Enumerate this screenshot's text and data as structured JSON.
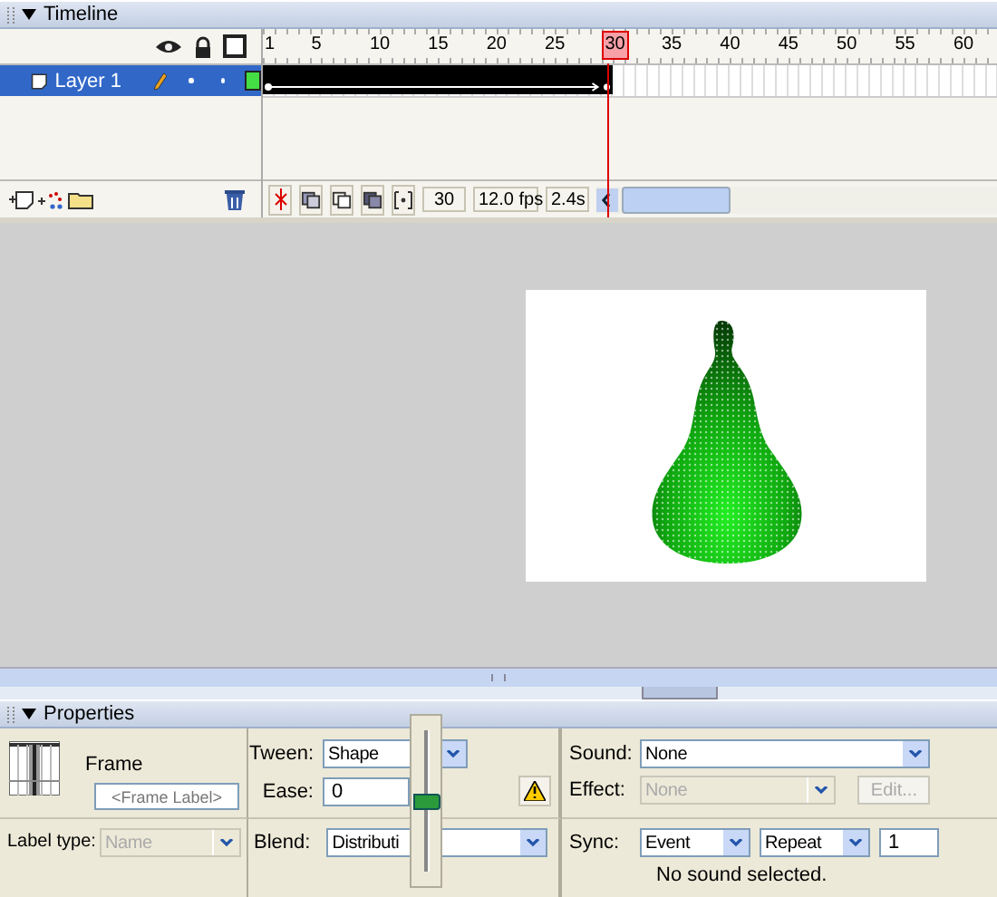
{
  "timeline": {
    "title": "Timeline",
    "layers": [
      {
        "name": "Layer 1",
        "selected": true,
        "color": "#44dd44"
      }
    ],
    "ruler": [
      {
        "label": "1",
        "selected": false
      },
      {
        "label": "5",
        "selected": false
      },
      {
        "label": "10",
        "selected": false
      },
      {
        "label": "15",
        "selected": false
      },
      {
        "label": "20",
        "selected": false
      },
      {
        "label": "25",
        "selected": false
      },
      {
        "label": "30",
        "selected": true
      },
      {
        "label": "35",
        "selected": false
      },
      {
        "label": "40",
        "selected": false
      },
      {
        "label": "45",
        "selected": false
      },
      {
        "label": "50",
        "selected": false
      },
      {
        "label": "55",
        "selected": false
      },
      {
        "label": "60",
        "selected": false
      }
    ],
    "toolbar": {
      "current_frame": "30",
      "frame_rate": "12.0 fps",
      "elapsed_time": "2.4s"
    }
  },
  "properties": {
    "title": "Properties",
    "frame_title": "Frame",
    "frame_label": {
      "placeholder": "<Frame Label>"
    },
    "label_type": {
      "label": "Label type:",
      "value": "Name",
      "disabled": true
    },
    "tween": {
      "label": "Tween:",
      "value": "Shape"
    },
    "ease": {
      "label": "Ease:",
      "value": "0",
      "level": 0.5
    },
    "blend": {
      "label": "Blend:",
      "value": "Distributi"
    },
    "sound": {
      "label": "Sound:",
      "value": "None"
    },
    "effect": {
      "label": "Effect:",
      "value": "None",
      "disabled": true
    },
    "edit_button": {
      "label": "Edit...",
      "disabled": true
    },
    "sync": {
      "label": "Sync:",
      "value": "Event"
    },
    "repeat": {
      "value": "Repeat"
    },
    "repeat_count": {
      "value": "1"
    },
    "sound_status": "No sound selected."
  }
}
